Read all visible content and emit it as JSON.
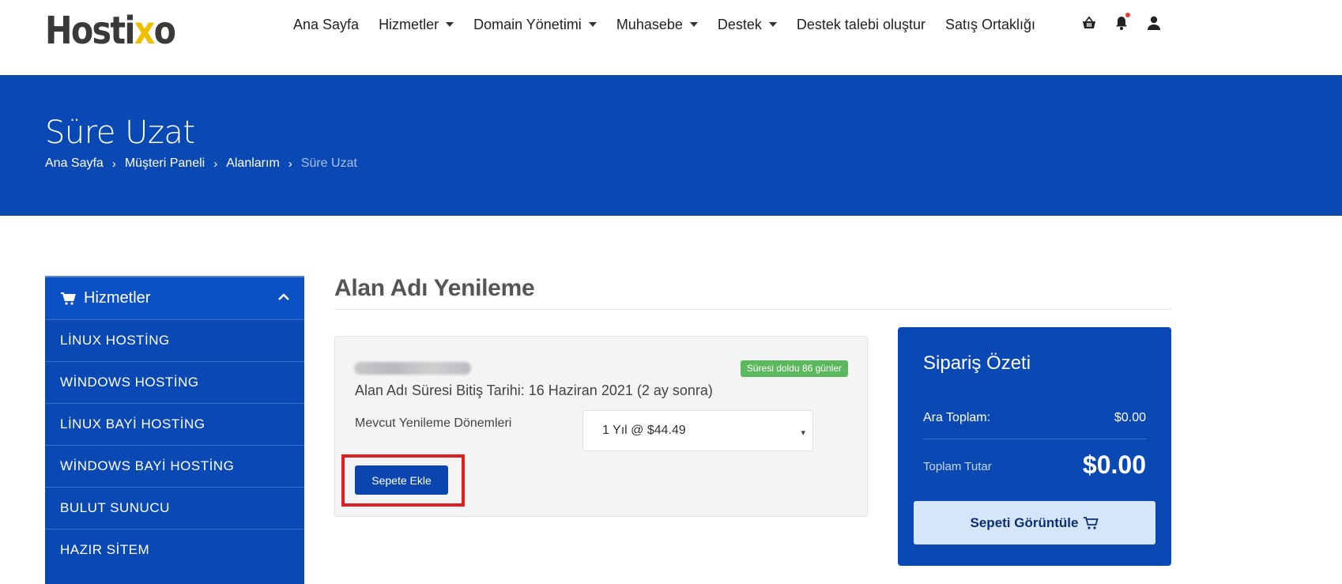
{
  "brand": {
    "logo_prefix": "Hosti",
    "logo_accent": "x",
    "logo_suffix": "o"
  },
  "nav": {
    "items": [
      {
        "label": "Ana Sayfa",
        "dropdown": false
      },
      {
        "label": "Hizmetler",
        "dropdown": true
      },
      {
        "label": "Domain Yönetimi",
        "dropdown": true
      },
      {
        "label": "Muhasebe",
        "dropdown": true
      },
      {
        "label": "Destek",
        "dropdown": true
      },
      {
        "label": "Destek talebi oluştur",
        "dropdown": false
      },
      {
        "label": "Satış Ortaklığı",
        "dropdown": false
      }
    ],
    "icons": [
      "basket-icon",
      "bell-icon",
      "user-icon"
    ]
  },
  "hero": {
    "title": "Süre Uzat",
    "breadcrumb": [
      "Ana Sayfa",
      "Müşteri Paneli",
      "Alanlarım",
      "Süre Uzat"
    ]
  },
  "sidebar": {
    "header": "Hizmetler",
    "items": [
      "LİNUX HOSTİNG",
      "WİNDOWS HOSTİNG",
      "LİNUX BAYİ HOSTİNG",
      "WİNDOWS BAYİ HOSTİNG",
      "BULUT SUNUCU",
      "HAZIR SİTEM"
    ]
  },
  "main": {
    "title": "Alan Adı Yenileme",
    "badge": "Süresi doldu 86 günler",
    "expiry": "Alan Adı Süresi Bitiş Tarihi: 16 Haziran 2021 (2 ay sonra)",
    "period_label": "Mevcut Yenileme Dönemleri",
    "period_value": "1 Yıl @ $44.49",
    "add_button": "Sepete Ekle"
  },
  "summary": {
    "title": "Sipariş Özeti",
    "subtotal_label": "Ara Toplam:",
    "subtotal_value": "$0.00",
    "total_label": "Toplam Tutar",
    "total_value": "$0.00",
    "view_cart": "Sepeti Görüntüle"
  },
  "colors": {
    "primary": "#0a49b4",
    "success": "#5cb85c",
    "highlight": "#e02020",
    "button_light": "#d5e6fb"
  }
}
